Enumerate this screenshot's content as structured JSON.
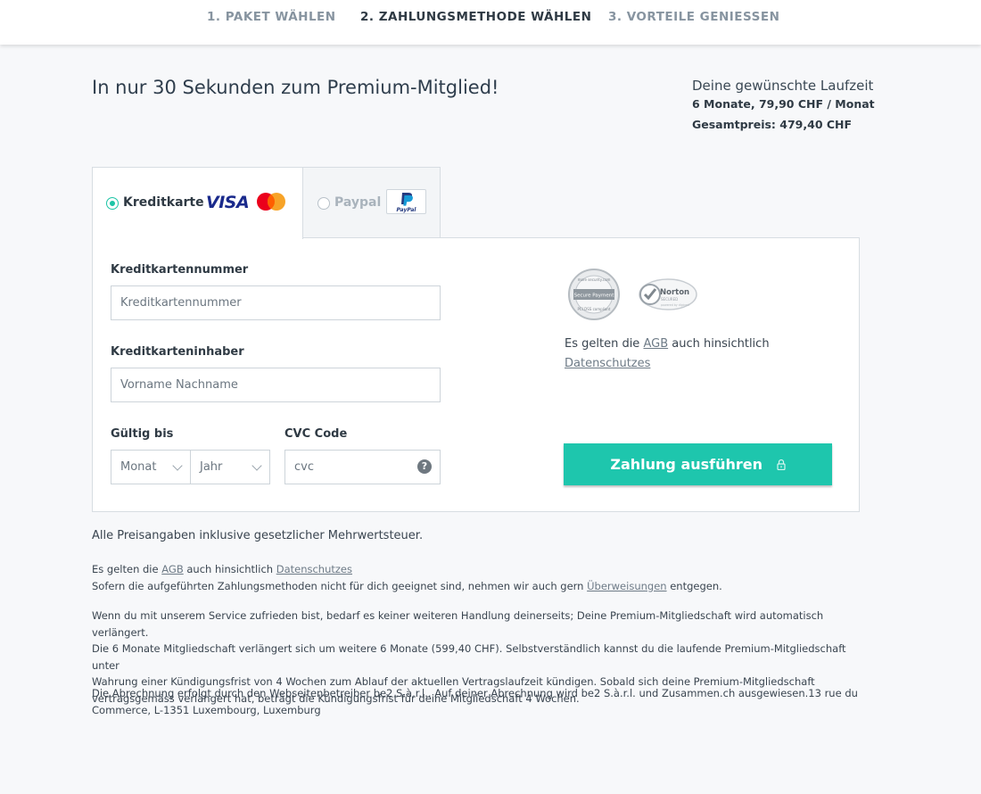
{
  "steps": [
    {
      "label": "1. PAKET WÄHLEN"
    },
    {
      "label": "2. ZAHLUNGSMETHODE WÄHLEN"
    },
    {
      "label": "3. VORTEILE GENIESSEN"
    }
  ],
  "headline": "In nur 30 Sekunden zum Premium-Mitglied!",
  "summary": {
    "label": "Deine gewünschte Laufzeit",
    "duration": "6 Monate, 79,90 CHF / Monat",
    "total": "Gesamtpreis: 479,40 CHF"
  },
  "tabs": {
    "card_label": "Kreditkarte",
    "visa_text": "VISA",
    "paypal_label": "Paypal",
    "paypal_logo_text": "PayPal"
  },
  "form": {
    "card_number_label": "Kreditkartennummer",
    "card_number_placeholder": "Kreditkartennummer",
    "holder_label": "Kreditkarteninhaber",
    "holder_placeholder": "Vorname Nachname",
    "valid_label": "Gültig bis",
    "month_value": "Monat",
    "year_value": "Jahr",
    "cvc_label": "CVC Code",
    "cvc_placeholder": "cvc",
    "help_glyph": "?"
  },
  "seals": {
    "secure_text_top": "more security.com",
    "secure_text_mid": "Secure Payment",
    "secure_text_bottom": "PCI DSS compliant",
    "norton_text": "Norton",
    "norton_sub": "SECURED",
    "norton_by": "powered by digicert"
  },
  "agb_box": {
    "prefix": "Es gelten die",
    "agb_link": "AGB",
    "middle": "auch hinsichtlich",
    "privacy_link": "Datenschutzes"
  },
  "pay_button": "Zahlung ausführen",
  "vat_note": "Alle Preisangaben inklusive gesetzlicher Mehrwertsteuer.",
  "legal": {
    "line1_prefix": "Es gelten die",
    "line1_agb": "AGB",
    "line1_middle": "auch hinsichtlich",
    "line1_privacy": "Datenschutzes",
    "line2_prefix": "Sofern die aufgeführten Zahlungsmethoden nicht für dich geeignet sind, nehmen wir auch gern",
    "line2_link": "Überweisungen",
    "line2_suffix": "entgegen.",
    "renewal_l1": "Wenn du mit unserem Service zufrieden bist, bedarf es keiner weiteren Handlung deinerseits; Deine Premium-Mitgliedschaft wird automatisch verlängert.",
    "renewal_l2": "Die 6 Monate Mitgliedschaft verlängert sich um weitere 6 Monate (599,40 CHF). Selbstverständlich kannst du die laufende Premium-Mitgliedschaft unter",
    "renewal_l3": "Wahrung einer Kündigungsfrist von 4 Wochen zum Ablauf der aktuellen Vertragslaufzeit kündigen. Sobald sich deine Premium-Mitgliedschaft",
    "renewal_l4": "vertragsgemäss verlängert hat, beträgt die Kündigungsfrist für deine Mitgliedschaft 4 Wochen.",
    "billing_l1": "Die Abrechnung erfolgt durch den Webseitenbetreiber be2 S.à.r.l.. Auf deiner Abrechnung wird be2 S.à.r.l. und Zusammen.ch ausgewiesen.13 rue du",
    "billing_l2": "Commerce, L-1351 Luxembourg, Luxemburg"
  },
  "colors": {
    "accent": "#1ec6ad",
    "radio_active": "#1cc4a6",
    "visa_blue": "#1a2a8c",
    "mc_red": "#eb001b",
    "mc_orange": "#f79e1b",
    "paypal_dark": "#253b80",
    "paypal_light": "#179bd7"
  },
  "icons": {
    "pay_lock": "lock-icon",
    "cvc_help": "help-icon",
    "select_arrow": "chevron-down-icon"
  }
}
